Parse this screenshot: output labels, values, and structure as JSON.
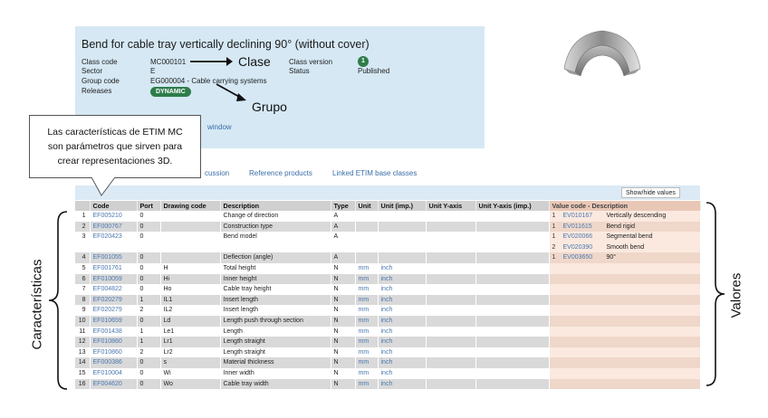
{
  "header": {
    "title": "Bend for cable tray vertically declining 90° (without cover)",
    "class_code_label": "Class code",
    "class_code_value": "MC000101",
    "sector_label": "Sector",
    "sector_value": "E",
    "group_code_label": "Group code",
    "group_code_value": "EG000004 - Cable carrying systems",
    "releases_label": "Releases",
    "releases_badge": "DYNAMIC",
    "class_version_label": "Class version",
    "class_version_value": "1",
    "status_label": "Status",
    "status_value": "Published",
    "window_link": "window"
  },
  "annotations": {
    "clase": "Clase",
    "grupo": "Grupo",
    "caracteristicas": "Características",
    "valores": "Valores",
    "callout_lines": [
      "Las características de ETIM MC",
      "son parámetros que sirven para",
      "crear representaciones 3D."
    ]
  },
  "tabs": [
    "cussion",
    "Reference products",
    "Linked ETIM base classes"
  ],
  "toolbar": {
    "show_hide_label": "Show/hide values"
  },
  "table": {
    "columns": [
      "",
      "Code",
      "Port",
      "Drawing code",
      "Description",
      "Type",
      "Unit",
      "Unit (imp.)",
      "Unit Y-axis",
      "Unit Y-axis (imp.)",
      "Value code - Description"
    ],
    "rows": [
      {
        "n": "1",
        "code": "EF005210",
        "port": "0",
        "drawing": "",
        "desc": "Change of direction",
        "type": "A",
        "unit": "",
        "unit_imp": "",
        "values": [
          {
            "i": "1",
            "code": "EV010167",
            "desc": "Vertically descending"
          }
        ]
      },
      {
        "n": "2",
        "code": "EF000767",
        "port": "0",
        "drawing": "",
        "desc": "Construction type",
        "type": "A",
        "unit": "",
        "unit_imp": "",
        "values": [
          {
            "i": "1",
            "code": "EV011615",
            "desc": "Bend rigid"
          }
        ]
      },
      {
        "n": "3",
        "code": "EF020423",
        "port": "0",
        "drawing": "",
        "desc": "Bend model",
        "type": "A",
        "unit": "",
        "unit_imp": "",
        "values": [
          {
            "i": "1",
            "code": "EV020066",
            "desc": "Segmental bend"
          },
          {
            "i": "2",
            "code": "EV020390",
            "desc": "Smooth bend"
          }
        ]
      },
      {
        "n": "4",
        "code": "EF001055",
        "port": "0",
        "drawing": "",
        "desc": "Deflection (angle)",
        "type": "A",
        "unit": "",
        "unit_imp": "",
        "values": [
          {
            "i": "1",
            "code": "EV003650",
            "desc": "90°"
          }
        ]
      },
      {
        "n": "5",
        "code": "EF001761",
        "port": "0",
        "drawing": "H",
        "desc": "Total height",
        "type": "N",
        "unit": "mm",
        "unit_imp": "inch",
        "values": []
      },
      {
        "n": "6",
        "code": "EF010059",
        "port": "0",
        "drawing": "Hi",
        "desc": "Inner height",
        "type": "N",
        "unit": "mm",
        "unit_imp": "inch",
        "values": []
      },
      {
        "n": "7",
        "code": "EF004822",
        "port": "0",
        "drawing": "Ho",
        "desc": "Cable tray height",
        "type": "N",
        "unit": "mm",
        "unit_imp": "inch",
        "values": []
      },
      {
        "n": "8",
        "code": "EF020279",
        "port": "1",
        "drawing": "IL1",
        "desc": "Insert length",
        "type": "N",
        "unit": "mm",
        "unit_imp": "inch",
        "values": []
      },
      {
        "n": "9",
        "code": "EF020279",
        "port": "2",
        "drawing": "IL2",
        "desc": "Insert length",
        "type": "N",
        "unit": "mm",
        "unit_imp": "inch",
        "values": []
      },
      {
        "n": "10",
        "code": "EF010659",
        "port": "0",
        "drawing": "Ld",
        "desc": "Length push through section",
        "type": "N",
        "unit": "mm",
        "unit_imp": "inch",
        "values": []
      },
      {
        "n": "11",
        "code": "EF001438",
        "port": "1",
        "drawing": "Le1",
        "desc": "Length",
        "type": "N",
        "unit": "mm",
        "unit_imp": "inch",
        "values": []
      },
      {
        "n": "12",
        "code": "EF010860",
        "port": "1",
        "drawing": "Lr1",
        "desc": "Length straight",
        "type": "N",
        "unit": "mm",
        "unit_imp": "inch",
        "values": []
      },
      {
        "n": "13",
        "code": "EF010860",
        "port": "2",
        "drawing": "Lr2",
        "desc": "Length straight",
        "type": "N",
        "unit": "mm",
        "unit_imp": "inch",
        "values": []
      },
      {
        "n": "14",
        "code": "EF000386",
        "port": "0",
        "drawing": "s",
        "desc": "Material thickness",
        "type": "N",
        "unit": "mm",
        "unit_imp": "inch",
        "values": []
      },
      {
        "n": "15",
        "code": "EF010004",
        "port": "0",
        "drawing": "Wi",
        "desc": "Inner width",
        "type": "N",
        "unit": "mm",
        "unit_imp": "inch",
        "values": []
      },
      {
        "n": "16",
        "code": "EF004620",
        "port": "0",
        "drawing": "Wo",
        "desc": "Cable tray width",
        "type": "N",
        "unit": "mm",
        "unit_imp": "inch",
        "values": []
      }
    ]
  }
}
